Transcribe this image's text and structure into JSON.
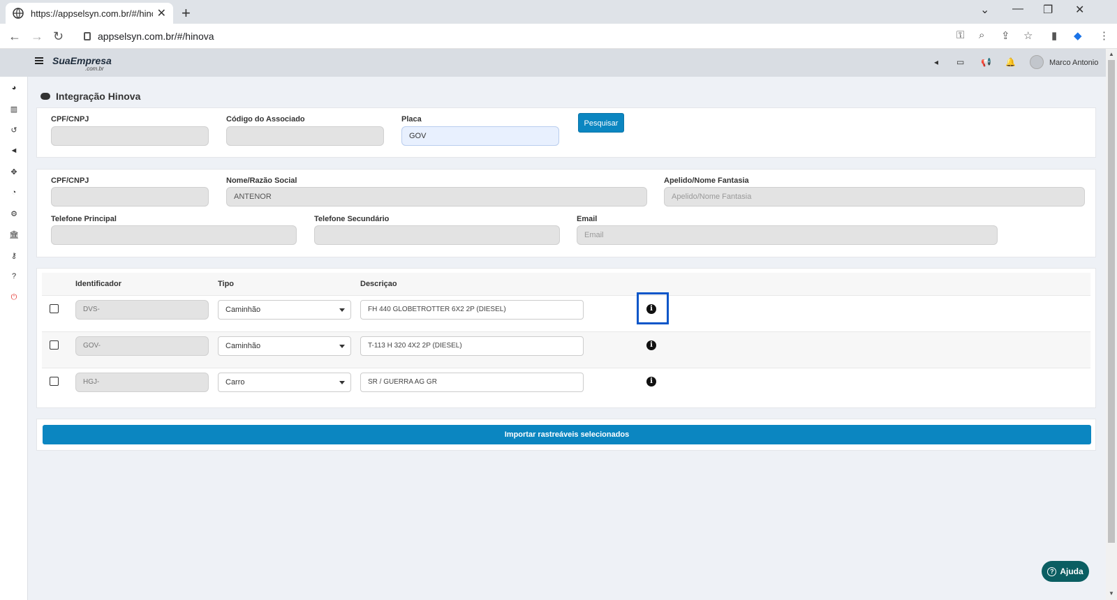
{
  "browser": {
    "tab_title": "https://appselsyn.com.br/#/hinov",
    "url": "appselsyn.com.br/#/hinova"
  },
  "header": {
    "logo": "SuaEmpresa",
    "logo_sub": ".com.br",
    "user_name": "Marco Antonio"
  },
  "page": {
    "title": "Integração Hinova"
  },
  "search": {
    "cpf_label": "CPF/CNPJ",
    "cpf_value": "",
    "codigo_label": "Código do Associado",
    "codigo_value": "",
    "placa_label": "Placa",
    "placa_value": "GOV",
    "button": "Pesquisar"
  },
  "client": {
    "cpf_label": "CPF/CNPJ",
    "cpf_value": "",
    "nome_label": "Nome/Razão Social",
    "nome_value": "ANTENOR",
    "apelido_label": "Apelido/Nome Fantasia",
    "apelido_placeholder": "Apelido/Nome Fantasia",
    "tel1_label": "Telefone Principal",
    "tel1_value": "",
    "tel2_label": "Telefone Secundário",
    "tel2_value": "",
    "email_label": "Email",
    "email_placeholder": "Email"
  },
  "table": {
    "headers": [
      "Identificador",
      "Tipo",
      "Descriçao"
    ],
    "rows": [
      {
        "id": "DVS-",
        "tipo": "Caminhão",
        "descricao": "FH 440 GLOBETROTTER 6X2 2P (DIESEL)"
      },
      {
        "id": "GOV-",
        "tipo": "Caminhão",
        "descricao": "T-113 H 320 4X2 2P (DIESEL)"
      },
      {
        "id": "HGJ-",
        "tipo": "Carro",
        "descricao": "SR / GUERRA AG GR"
      }
    ],
    "info_glyph": "i"
  },
  "actions": {
    "import_button": "Importar rastreáveis selecionados",
    "help_button": "Ajuda"
  },
  "colors": {
    "primary": "#0b86c1",
    "help": "#0b5e62",
    "focus": "#0a56c9"
  }
}
